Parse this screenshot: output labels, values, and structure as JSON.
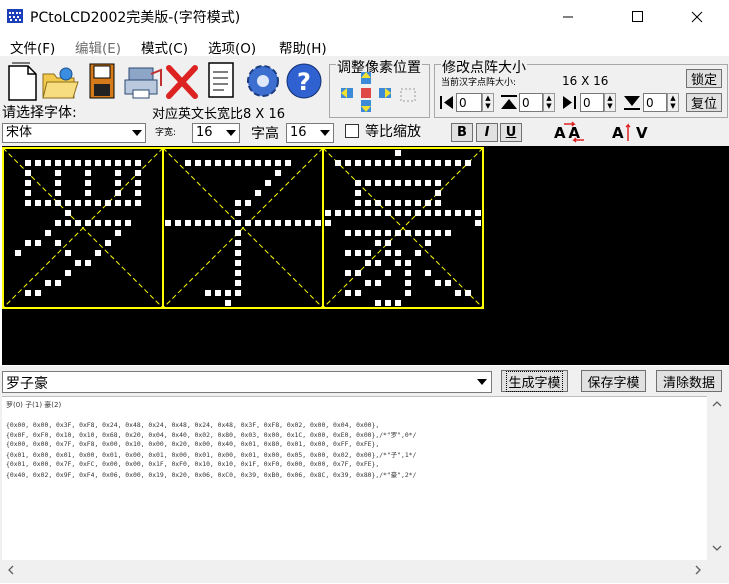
{
  "window": {
    "title": "PCtoLCD2002完美版-(字符模式)",
    "icon_name": "app-icon",
    "controls": [
      "minimize",
      "maximize",
      "close"
    ]
  },
  "menu": [
    {
      "label": "文件(F)",
      "enabled": true
    },
    {
      "label": "编辑(E)",
      "enabled": false
    },
    {
      "label": "模式(C)",
      "enabled": true
    },
    {
      "label": "选项(O)",
      "enabled": true
    },
    {
      "label": "帮助(H)",
      "enabled": true
    }
  ],
  "toolbar": {
    "icons": [
      "new-file-icon",
      "open-folder-icon",
      "save-disk-icon",
      "print-icon",
      "delete-x-icon",
      "notes-icon",
      "settings-gear-icon",
      "help-icon"
    ],
    "adjust_pixel_label": "调整像素位置",
    "modify_matrix_label": "修改点阵大小",
    "current_size_label": "当前汉字点阵大小:",
    "current_size_value": "16  X  16",
    "lock_button": "锁定",
    "reset_button": "复位",
    "spin_values": [
      "0",
      "0",
      "0",
      "0"
    ]
  },
  "font_row": {
    "select_font_label": "请选择字体:",
    "english_ratio_label": "对应英文长宽比",
    "english_ratio_value": "8 X 16",
    "font_name": "宋体",
    "width_label": "字宽:",
    "width_value": "16",
    "height_label": "字高",
    "height_value": "16",
    "scale_checkbox_label": "等比缩放",
    "scale_checked": false,
    "bold_label": "B",
    "italic_label": "I",
    "underline_label": "U"
  },
  "glyphs": [
    {
      "char": "罗",
      "rows": [
        "0000000000000000",
        "0011111111111100",
        "0010010010010100",
        "0010010010010100",
        "0010010010010100",
        "0011111111111100",
        "0000001000000000",
        "0000011111111000",
        "0000100000010000",
        "0011010000100000",
        "0100001001000000",
        "0000000110000000",
        "0000001000000000",
        "0000110000000000",
        "0011000000000000",
        "0000000000000000"
      ]
    },
    {
      "char": "子",
      "rows": [
        "0000000000000000",
        "0011111111111000",
        "0000000000010000",
        "0000000000100000",
        "0000000001000000",
        "0000000110000000",
        "0000000100000000",
        "1111111111111111",
        "0000000100000000",
        "0000000100000000",
        "0000000100000000",
        "0000000100000000",
        "0000000100000000",
        "0000000100000000",
        "0000111100000000",
        "0000001000000000"
      ]
    },
    {
      "char": "豪",
      "rows": [
        "0000000100000000",
        "0111111111111110",
        "0000000000000000",
        "0001111111110000",
        "0001000000010000",
        "0001111111110000",
        "1111111111111111",
        "1000000000000001",
        "0011111111111000",
        "0000011000100000",
        "0011101101000000",
        "0000110110000000",
        "0011001010100000",
        "0000110010011000",
        "0011000010000110",
        "0000011100000000"
      ]
    }
  ],
  "input_text": "罗子豪",
  "buttons": {
    "generate": "生成字模",
    "save": "保存字模",
    "clear": "清除数据"
  },
  "output": {
    "header": "罗(0) 子(1) 豪(2)",
    "lines": [
      "{0x00, 0x00, 0x3F, 0xF8, 0x24, 0x48, 0x24, 0x48, 0x24, 0x48, 0x3F, 0xF8, 0x02, 0x00, 0x04, 0x00},",
      "{0x0F, 0xF0, 0x10, 0x10, 0x68, 0x20, 0x04, 0x40, 0x02, 0x80, 0x03, 0x00, 0x1C, 0x00, 0xE0, 0x00},/*\"罗\",0*/",
      "{0x00, 0x00, 0x7F, 0xF8, 0x00, 0x10, 0x00, 0x20, 0x00, 0x40, 0x01, 0x80, 0x01, 0x00, 0xFF, 0xFE},",
      "{0x01, 0x00, 0x01, 0x00, 0x01, 0x00, 0x01, 0x00, 0x01, 0x00, 0x01, 0x00, 0x05, 0x00, 0x02, 0x00},/*\"子\",1*/",
      "{0x01, 0x00, 0x7F, 0xFC, 0x00, 0x00, 0x1F, 0xF0, 0x10, 0x10, 0x1F, 0xF0, 0x00, 0x00, 0x7F, 0xFE},",
      "{0x40, 0x02, 0x9F, 0xF4, 0x06, 0x00, 0x19, 0x20, 0x06, 0xC0, 0x39, 0xB0, 0x06, 0x8C, 0x39, 0x80},/*\"豪\",2*/"
    ]
  },
  "colors": {
    "canvas_bg": "#000000",
    "grid_yellow": "#ffff00",
    "dot_white": "#ffffff",
    "window_bg": "#f0f0f0"
  }
}
